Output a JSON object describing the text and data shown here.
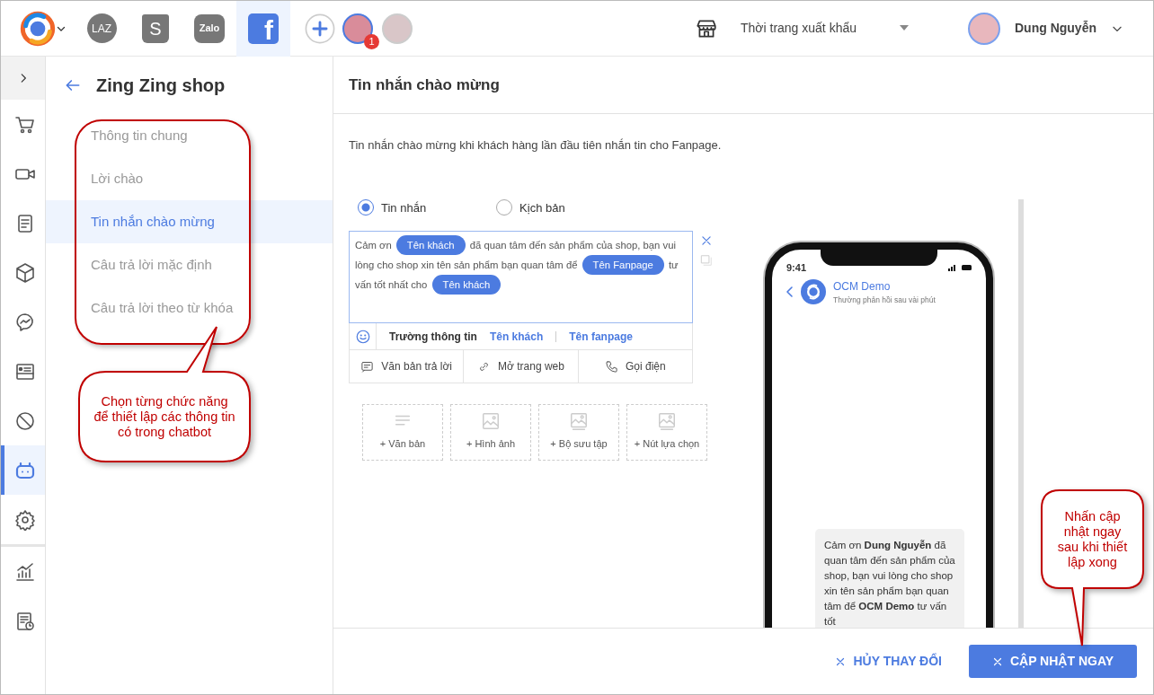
{
  "topbar": {
    "channels": [
      {
        "kind": "logo",
        "selected": false
      },
      {
        "kind": "lazada",
        "label": "LAZ",
        "selected": false
      },
      {
        "kind": "shopee",
        "label": "S",
        "selected": false
      },
      {
        "kind": "zalo",
        "label": "Zalo",
        "selected": false
      },
      {
        "kind": "facebook",
        "label": "f",
        "selected": true
      }
    ],
    "pages": [
      {
        "badge": "1",
        "selected": true
      },
      {
        "selected": false
      }
    ],
    "shop": "Thời trang xuất khẩu",
    "user": "Dung Nguyễn"
  },
  "rail": [
    {
      "kind": "cart",
      "selected": false
    },
    {
      "kind": "video",
      "selected": false
    },
    {
      "kind": "doc",
      "selected": false
    },
    {
      "kind": "box",
      "selected": false
    },
    {
      "kind": "messenger",
      "selected": false
    },
    {
      "kind": "card",
      "selected": false
    },
    {
      "kind": "ban",
      "selected": false
    },
    {
      "kind": "bot",
      "selected": true
    },
    {
      "kind": "gear",
      "selected": false
    },
    {
      "kind": "chart",
      "selected": false
    },
    {
      "kind": "report",
      "selected": false
    }
  ],
  "menu": {
    "title": "Zing Zing shop",
    "items": [
      {
        "label": "Thông tin chung",
        "selected": false
      },
      {
        "label": "Lời chào",
        "selected": false
      },
      {
        "label": "Tin nhắn chào mừng",
        "selected": true
      },
      {
        "label": "Câu trả lời mặc định",
        "selected": false
      },
      {
        "label": "Câu trả lời theo từ khóa",
        "selected": false
      }
    ]
  },
  "content": {
    "title": "Tin nhắn chào mừng",
    "description": "Tin nhắn chào mừng khi khách hàng lần đầu tiên nhắn tin cho Fanpage.",
    "modes": [
      {
        "label": "Tin nhắn",
        "selected": true
      },
      {
        "label": "Kịch bản",
        "selected": false
      }
    ],
    "message": [
      {
        "kind": "text",
        "text": "Cảm ơn "
      },
      {
        "kind": "tag",
        "text": "Tên khách"
      },
      {
        "kind": "text",
        "text": " đã quan tâm đến sản phẩm của shop, bạn vui lòng cho shop xin tên sản phẩm bạn quan tâm để "
      },
      {
        "kind": "tag",
        "text": "Tên Fanpage"
      },
      {
        "kind": "text",
        "text": " tư vấn tốt nhất cho "
      },
      {
        "kind": "tag",
        "text": "Tên khách"
      }
    ],
    "fields_label": "Trường thông tin",
    "fields": [
      "Tên khách",
      "Tên fanpage"
    ],
    "actions": [
      {
        "kind": "reply",
        "label": "Văn bản trả lời"
      },
      {
        "kind": "link",
        "label": "Mở trang web"
      },
      {
        "kind": "phone",
        "label": "Gọi điện"
      }
    ],
    "blocks": [
      {
        "kind": "text",
        "label": "+ Văn bản"
      },
      {
        "kind": "image",
        "label": "+ Hình ảnh"
      },
      {
        "kind": "gallery",
        "label": "+ Bộ sưu tập"
      },
      {
        "kind": "gallery",
        "label": "+ Nút lựa chọn"
      }
    ],
    "preview": {
      "time": "9:41",
      "page": "OCM Demo",
      "subtitle": "Thường phản hồi sau vài phút",
      "bubble": "Cảm ơn **Dung Nguyễn** đã quan tâm đến sản phẩm của shop, bạn vui lòng cho shop xin tên sản phẩm bạn quan tâm để **OCM Demo** tư vấn tốt"
    },
    "cancel": "HỦY THAY ĐỔI",
    "save": "CẬP NHẬT NGAY"
  },
  "callouts": [
    {
      "kind": "menu",
      "text": "Chọn từng chức năng để thiết lập các thông tin có trong chatbot"
    },
    {
      "kind": "save",
      "text": "Nhấn cập nhật ngay sau khi thiết lập xong"
    }
  ]
}
